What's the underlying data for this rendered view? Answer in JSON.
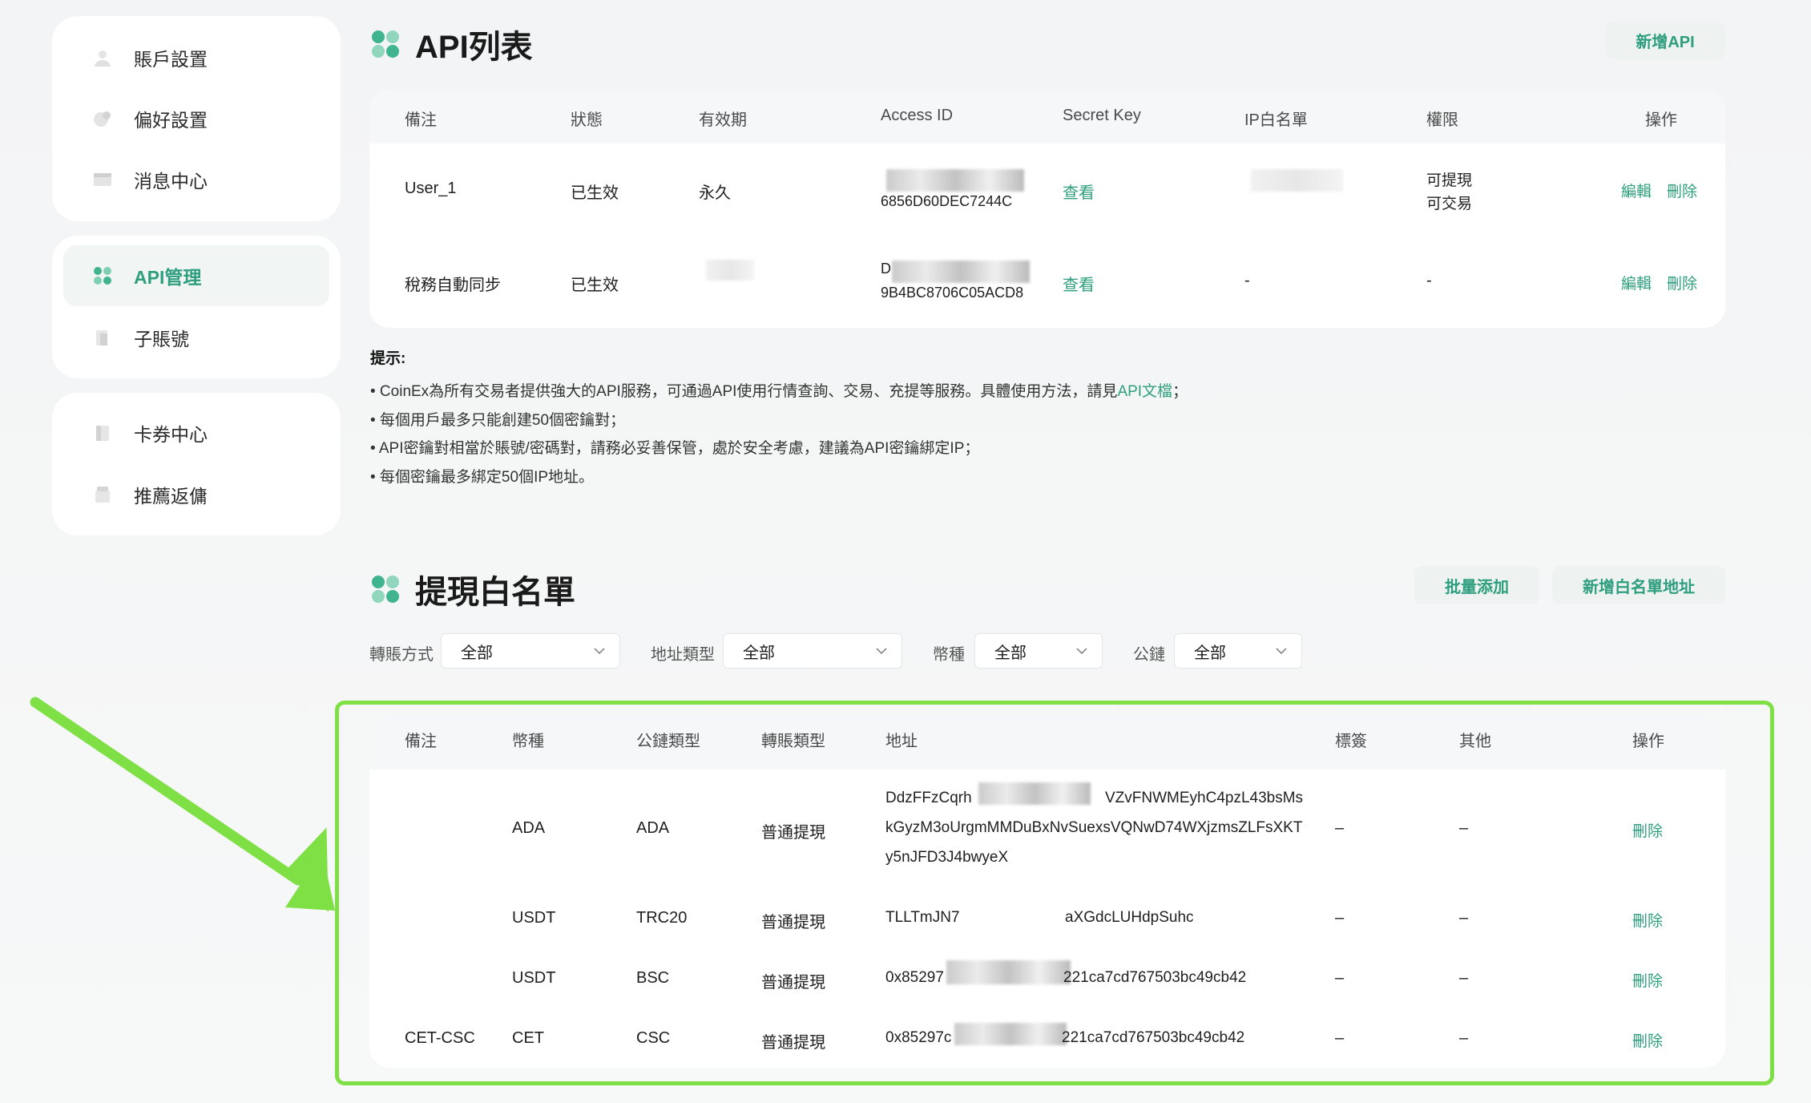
{
  "sidebar": {
    "group1": [
      {
        "label": "賬戶設置",
        "icon": "user-icon"
      },
      {
        "label": "偏好設置",
        "icon": "preferences-icon"
      },
      {
        "label": "消息中心",
        "icon": "message-icon"
      }
    ],
    "group2": [
      {
        "label": "API管理",
        "icon": "api-icon",
        "active": true
      },
      {
        "label": "子賬號",
        "icon": "sub-account-icon"
      }
    ],
    "group3": [
      {
        "label": "卡券中心",
        "icon": "coupon-icon"
      },
      {
        "label": "推薦返傭",
        "icon": "referral-icon"
      }
    ]
  },
  "api_section": {
    "title": "API列表",
    "add_button": "新增API",
    "headers": [
      "備注",
      "狀態",
      "有效期",
      "Access ID",
      "Secret Key",
      "IP白名單",
      "權限",
      "操作"
    ],
    "rows": [
      {
        "note": "User_1",
        "status": "已生效",
        "validity": "永久",
        "access_id": "6856D60DEC7244C",
        "secret": "查看",
        "ip": "",
        "permission": [
          "可提現",
          "可交易"
        ],
        "edit": "編輯",
        "delete": "刪除"
      },
      {
        "note": "稅務自動同步",
        "status": "已生效",
        "validity": "",
        "access_id_top": "D",
        "access_id": "9B4BC8706C05ACD8",
        "secret": "查看",
        "ip": "-",
        "permission": [
          "-"
        ],
        "edit": "編輯",
        "delete": "刪除"
      }
    ]
  },
  "tips": {
    "title": "提示:",
    "line1_prefix": "• CoinEx為所有交易者提供強大的API服務，可通過API使用行情查詢、交易、充提等服務。具體使用方法，請見",
    "line1_link": "API文檔",
    "line1_suffix": "；",
    "line2": "• 每個用戶最多只能創建50個密鑰對；",
    "line3": "• API密鑰對相當於賬號/密碼對，請務必妥善保管，處於安全考慮，建議為API密鑰綁定IP；",
    "line4": "• 每個密鑰最多綁定50個IP地址。"
  },
  "whitelist_section": {
    "title": "提現白名單",
    "batch_button": "批量添加",
    "add_button": "新增白名單地址",
    "filters": [
      {
        "label": "轉賬方式",
        "value": "全部"
      },
      {
        "label": "地址類型",
        "value": "全部"
      },
      {
        "label": "幣種",
        "value": "全部"
      },
      {
        "label": "公鏈",
        "value": "全部"
      }
    ],
    "headers": [
      "備注",
      "幣種",
      "公鏈類型",
      "轉賬類型",
      "地址",
      "標簽",
      "其他",
      "操作"
    ],
    "rows": [
      {
        "note": "",
        "coin": "ADA",
        "chain": "ADA",
        "type": "普通提現",
        "addr": [
          "DdzFFzCqrh",
          "VZvFNWMEyhC4pzL43bsMs",
          "kGyzM3oUrgmMMDuBxNvSuexsVQNwD74WXjzmsZLFsXKT",
          "y5nJFD3J4bwyeX"
        ],
        "tag": "–",
        "other": "–",
        "delete": "刪除"
      },
      {
        "note": "",
        "coin": "USDT",
        "chain": "TRC20",
        "type": "普通提現",
        "addr": [
          "TLLTmJN7",
          "aXGdcLUHdpSuhc"
        ],
        "tag": "–",
        "other": "–",
        "delete": "刪除"
      },
      {
        "note": "",
        "coin": "USDT",
        "chain": "BSC",
        "type": "普通提現",
        "addr": [
          "0x85297",
          "221ca7cd767503bc49cb42"
        ],
        "tag": "–",
        "other": "–",
        "delete": "刪除"
      },
      {
        "note": "CET-CSC",
        "coin": "CET",
        "chain": "CSC",
        "type": "普通提現",
        "addr": [
          "0x85297c",
          "221ca7cd767503bc49cb42"
        ],
        "tag": "–",
        "other": "–",
        "delete": "刪除"
      }
    ]
  },
  "colors": {
    "accent": "#2e9e7e",
    "highlight": "#7fe045"
  }
}
